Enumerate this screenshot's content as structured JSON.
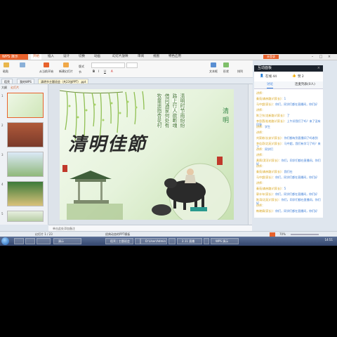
{
  "app": {
    "name": "WPS 演示",
    "menu": [
      "开始",
      "插入",
      "设计",
      "切换",
      "动画",
      "幻灯片放映",
      "审阅",
      "视图",
      "特色应用"
    ],
    "active_menu": "开始",
    "login": "未登录"
  },
  "ribbon": {
    "paste": "粘贴",
    "from_current": "从当前开始",
    "new_slide": "新建幻灯片",
    "layout": "版式",
    "section": "节",
    "textbox": "文本框",
    "shape": "形状",
    "sort": "排列"
  },
  "doc_tabs": [
    {
      "label": "稻壳",
      "active": false
    },
    {
      "label": "我的WPS",
      "active": false
    },
    {
      "label": "清明节主题班会（共23张PPT）.ppt",
      "active": true
    }
  ],
  "left_panel": {
    "tabs": [
      "大纲",
      "幻灯片"
    ],
    "slide_numbers": [
      "1",
      "2",
      "3",
      "4",
      "5"
    ]
  },
  "slide": {
    "calligraphy": "清明佳節",
    "corner_title": "清明",
    "poem": [
      "清明时节雨纷纷",
      "路上行人欲断魂",
      "借问酒家何处有",
      "牧童遥指杏花村"
    ]
  },
  "notes_placeholder": "单击此处添加备注",
  "statusbar": {
    "slide_counter": "幻灯片 1 / 23",
    "template": "经典动态的PPT模板",
    "zoom": "70%"
  },
  "taskbar": {
    "items": [
      "",
      "",
      "",
      "演示",
      "稻壳 | 主题班会",
      "",
      "D:\\User\\Admin",
      "",
      "2.11 直播",
      "",
      "WPS 演示"
    ],
    "clock": "14:51"
  },
  "interactive_panel": {
    "title": "互动面板",
    "online_label": "在线 44",
    "likes_label": "赞 2",
    "tabs": [
      "讨论",
      "连麦列表(0人)"
    ],
    "active_tab": "讨论",
    "messages": [
      {
        "user": "讲师：",
        "text": ""
      },
      {
        "user": "秦苑(森林路)/(家长)：",
        "text": "1"
      },
      {
        "user": "马中超(家长)：",
        "text": "你们，同学们都在直播间，你们好"
      },
      {
        "user": "讲师：",
        "text": ""
      },
      {
        "user": "陈卫东(龙新路)/(家长)：",
        "text": "了"
      },
      {
        "user": "李思茜(松柏路)/(家长)：",
        "text": "上午好我们了吗？来了没有回答"
      },
      {
        "user": "讲师：",
        "text": "学生"
      },
      {
        "user": "讲师：",
        "text": ""
      },
      {
        "user": "刘家栋(长安)/(家长)：",
        "text": "你们都有到直播间了吗收到"
      },
      {
        "user": "李佳奇(北苑)/(家长)：",
        "text": "马中超，我们有学习了吗？来了"
      },
      {
        "user": "讲师：",
        "text": "同学们"
      },
      {
        "user": "讲师：",
        "text": ""
      },
      {
        "user": "黄莉(滨河)/(家长)：",
        "text": "你们，同学们都在直播间，你们好"
      },
      {
        "user": "讲师：",
        "text": ""
      },
      {
        "user": "秦苑(森林路)/(家长)：",
        "text": "我们在"
      },
      {
        "user": "马中超(家长)：",
        "text": "你们，同学们都在直播间，你们好"
      },
      {
        "user": "讲师：",
        "text": ""
      },
      {
        "user": "秦苑(森林路)/(家长)：",
        "text": "5"
      },
      {
        "user": "郭丰年(家长)：",
        "text": "你们，同学们都在直播间，你们好"
      },
      {
        "user": "陈涛(北苑)/(家长)：",
        "text": "你们，同学们都在直播间，你们好"
      },
      {
        "user": "讲师：",
        "text": ""
      },
      {
        "user": "韩晓倩(家长)：",
        "text": "你们，同学们都在直播间，你们好"
      }
    ]
  },
  "colors": {
    "accent_orange": "#e8622c",
    "panel_dark": "#232b36",
    "chat_user": "#d7a31a",
    "chat_text": "#3a7bd5"
  }
}
